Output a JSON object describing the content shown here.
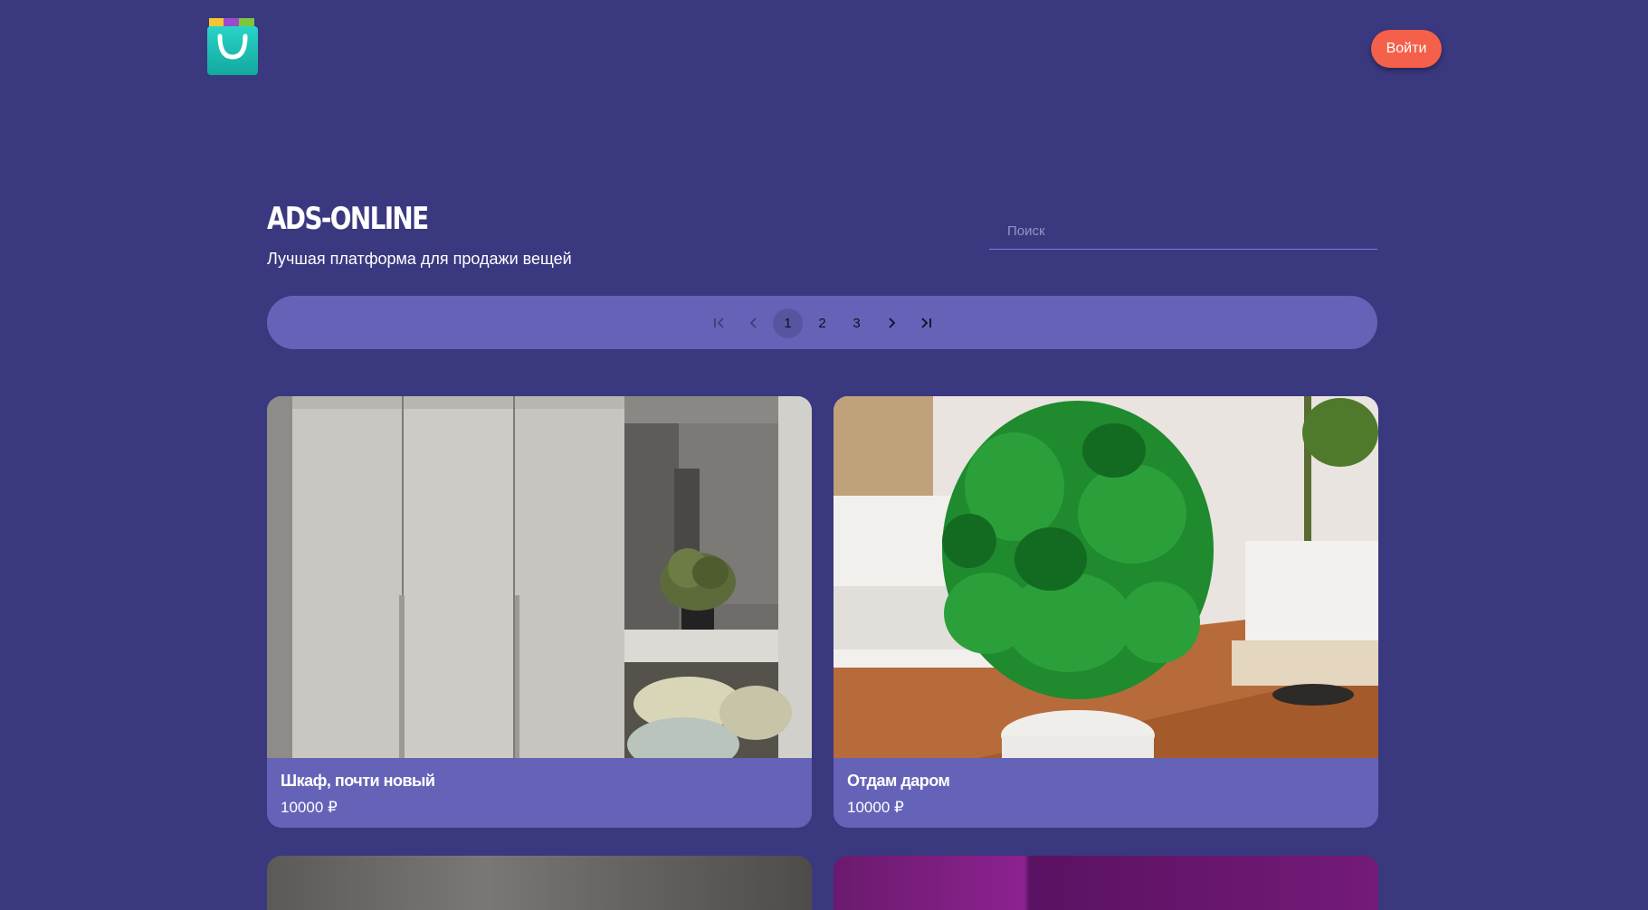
{
  "header": {
    "logo_icon": "shopping-bag-icon",
    "login_label": "Войти",
    "accent_color": "#f4604a"
  },
  "hero": {
    "title": "ADS-ONLINE",
    "subtitle": "Лучшая платформа для продажи вещей",
    "search_placeholder": "Поиск"
  },
  "pagination": {
    "first_icon": "first-page-icon",
    "prev_icon": "chevron-left-icon",
    "pages": [
      "1",
      "2",
      "3"
    ],
    "current_page": "1",
    "next_icon": "chevron-right-icon",
    "last_icon": "last-page-icon"
  },
  "ads": [
    {
      "title": "Шкаф, почти новый",
      "price": "10000 ₽",
      "image": "wardrobe-photo"
    },
    {
      "title": "Отдам даром",
      "price": "10000 ₽",
      "image": "plant-photo"
    }
  ],
  "colors": {
    "background": "#3a387f",
    "panel": "#6563b8"
  }
}
